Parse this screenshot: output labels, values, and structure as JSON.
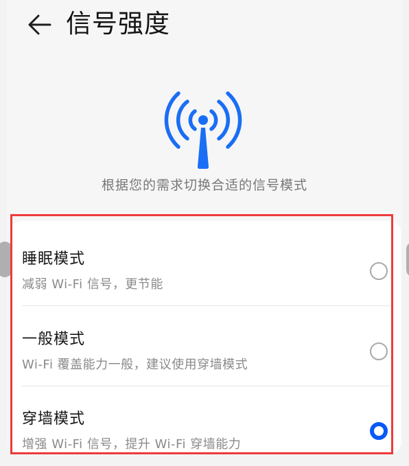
{
  "header": {
    "title": "信号强度",
    "back_icon": "arrow-left-icon"
  },
  "hero": {
    "icon": "wifi-signal-tower-icon",
    "accent_color": "#1a6ef5",
    "subtitle": "根据您的需求切换合适的信号模式"
  },
  "options": [
    {
      "label": "睡眠模式",
      "description": "减弱 Wi-Fi 信号，更节能",
      "selected": false
    },
    {
      "label": "一般模式",
      "description": "Wi-Fi 覆盖能力一般，建议使用穿墙模式",
      "selected": false
    },
    {
      "label": "穿墙模式",
      "description": "增强 Wi-Fi 信号，提升 Wi-Fi 穿墙能力",
      "selected": true
    }
  ],
  "colors": {
    "radio_selected": "#0a59f7",
    "highlight_frame": "#ee3a3a"
  }
}
